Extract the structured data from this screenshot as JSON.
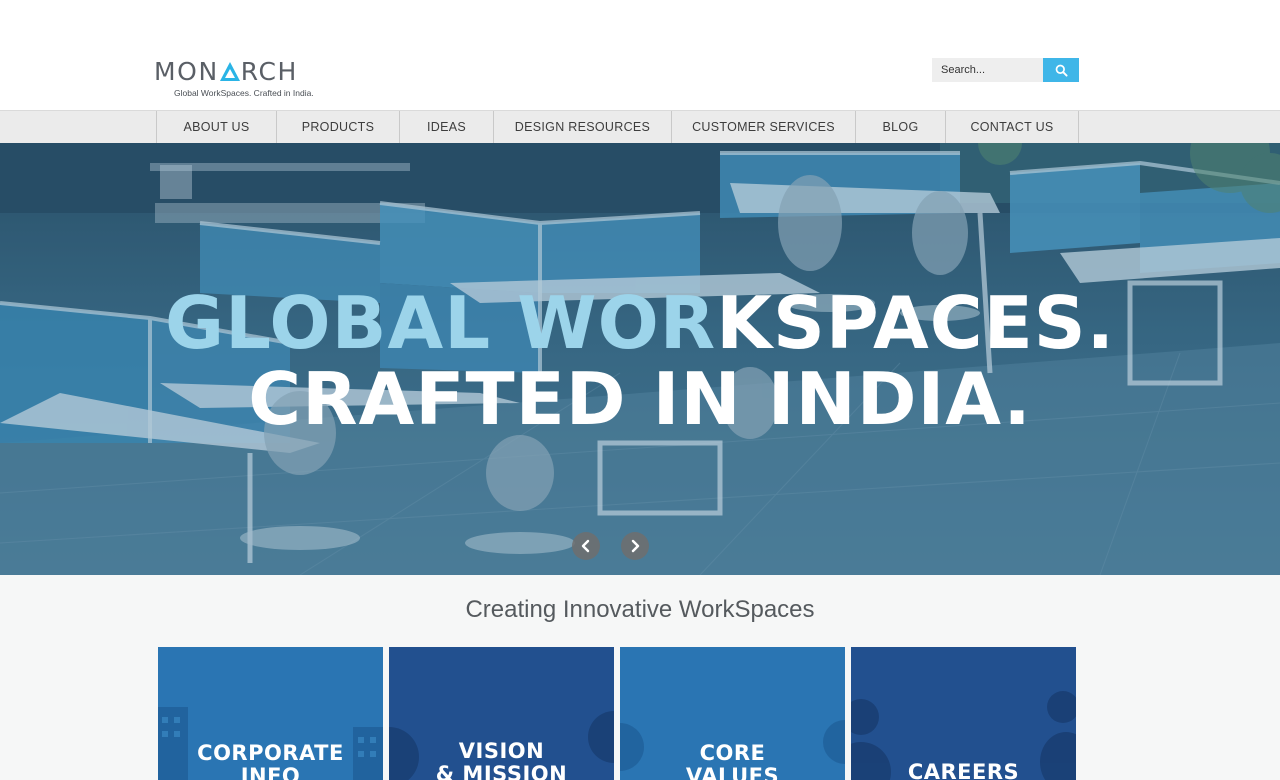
{
  "brand": {
    "logo_prefix": "MON",
    "logo_suffix": "RCH",
    "tagline": "Global WorkSpaces. Crafted in India.",
    "accent_color": "#2ab4e6"
  },
  "search": {
    "placeholder": "Search...",
    "icon": "search-icon",
    "button_color": "#3fb6e8"
  },
  "nav": {
    "items": [
      {
        "label": "ABOUT US"
      },
      {
        "label": "PRODUCTS"
      },
      {
        "label": "IDEAS"
      },
      {
        "label": "DESIGN RESOURCES"
      },
      {
        "label": "CUSTOMER SERVICES"
      },
      {
        "label": "BLOG"
      },
      {
        "label": "CONTACT US"
      }
    ]
  },
  "hero": {
    "line1_highlight": "GLOBAL WOR",
    "line1_rest": "KSPACES.",
    "line2": "CRAFTED IN INDIA.",
    "prev_icon": "chevron-left-icon",
    "next_icon": "chevron-right-icon"
  },
  "section": {
    "title": "Creating Innovative WorkSpaces"
  },
  "tiles": [
    {
      "line1": "CORPORATE",
      "line2": "INFO",
      "color": "#2a75b3"
    },
    {
      "line1": "VISION",
      "line2": "& MISSION",
      "color": "#22508f"
    },
    {
      "line1": "CORE",
      "line2": "VALUES",
      "color": "#2a75b3"
    },
    {
      "line1": "CAREERS",
      "line2": "",
      "color": "#22508f"
    }
  ]
}
